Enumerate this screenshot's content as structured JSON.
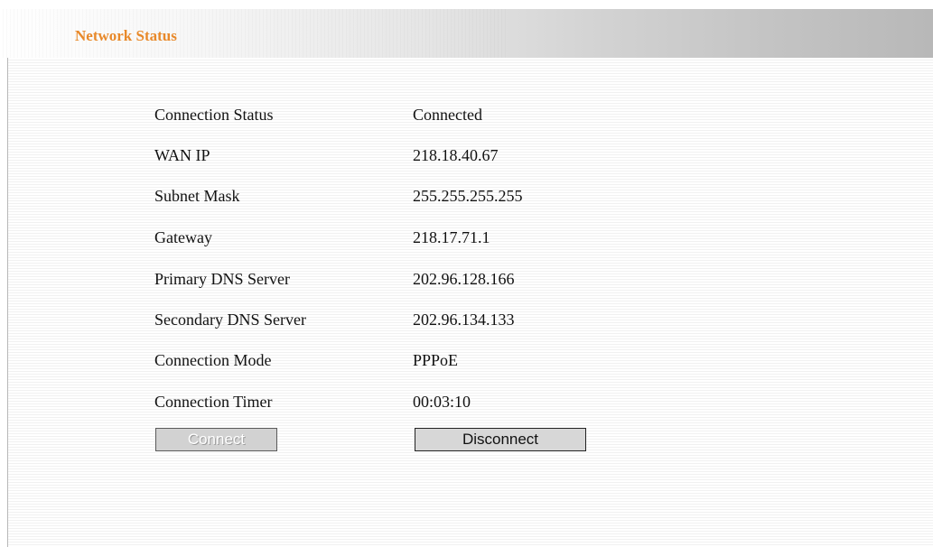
{
  "header": {
    "title": "Network Status"
  },
  "status_rows": [
    {
      "label": "Connection Status",
      "value": "Connected"
    },
    {
      "label": "WAN IP",
      "value": "218.18.40.67"
    },
    {
      "label": "Subnet Mask",
      "value": "255.255.255.255"
    },
    {
      "label": "Gateway",
      "value": "218.17.71.1"
    },
    {
      "label": "Primary DNS Server",
      "value": "202.96.128.166"
    },
    {
      "label": "Secondary DNS Server",
      "value": "202.96.134.133"
    },
    {
      "label": "Connection Mode",
      "value": "PPPoE"
    },
    {
      "label": "Connection Timer",
      "value": "00:03:10"
    }
  ],
  "buttons": {
    "connect_label": "Connect",
    "connect_state": "disabled",
    "disconnect_label": "Disconnect"
  },
  "colors": {
    "title": "#e8892a",
    "button_face": "#d7d7d7"
  }
}
